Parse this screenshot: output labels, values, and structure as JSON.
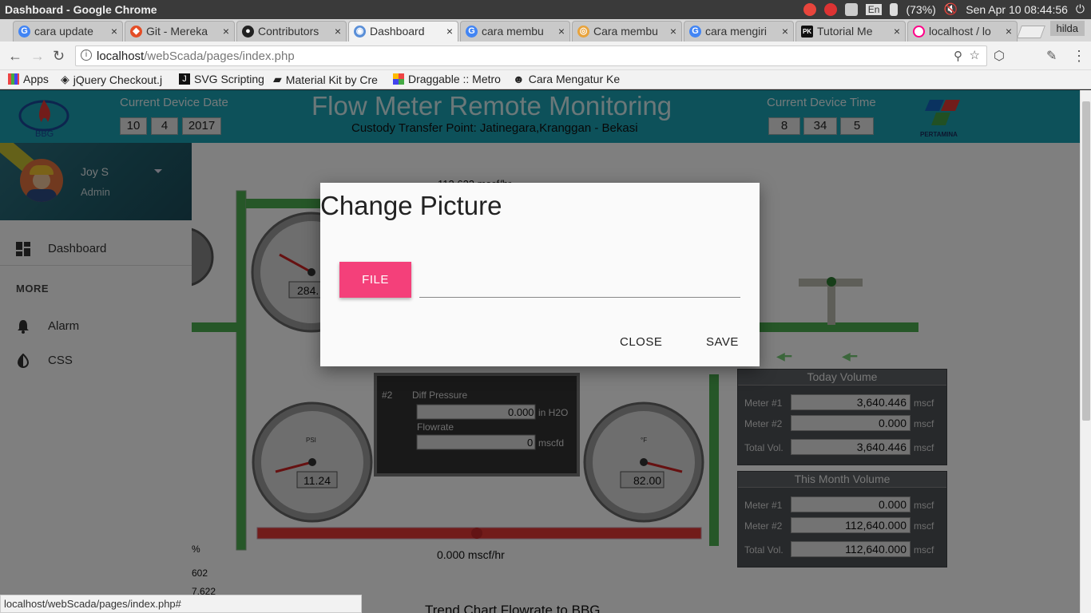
{
  "os": {
    "window_title": "Dashboard - Google Chrome",
    "keyboard": "En",
    "battery": "(73%)",
    "clock": "Sen Apr 10 08:44:56"
  },
  "tabs": [
    {
      "label": "cara update",
      "favicon": "google-icon"
    },
    {
      "label": "Git - Mereka",
      "favicon": "git-icon"
    },
    {
      "label": "Contributors",
      "favicon": "github-icon"
    },
    {
      "label": "Dashboard",
      "favicon": "app-icon"
    },
    {
      "label": "cara membu",
      "favicon": "google-icon"
    },
    {
      "label": "Cara membu",
      "favicon": "site-icon"
    },
    {
      "label": "cara mengiri",
      "favicon": "google-icon"
    },
    {
      "label": "Tutorial Me",
      "favicon": "pk-icon"
    },
    {
      "label": "localhost / lo",
      "favicon": "loading-icon"
    }
  ],
  "profile_chip": "hilda",
  "address": {
    "host": "localhost",
    "path": "/webScada/pages/index.php"
  },
  "bookmarks": [
    {
      "label": "Apps"
    },
    {
      "label": "jQuery Checkout.j"
    },
    {
      "label": "SVG Scripting"
    },
    {
      "label": "Material Kit by Cre"
    },
    {
      "label": "Draggable :: Metro"
    },
    {
      "label": "Cara Mengatur Ke"
    }
  ],
  "header": {
    "title": "Flow Meter Remote Monitoring",
    "subtitle": "Custody Transfer Point: Jatinegara,Kranggan - Bekasi",
    "date_label": "Current Device Date",
    "date": [
      "10",
      "4",
      "2017"
    ],
    "time_label": "Current Device Time",
    "time": [
      "8",
      "34",
      "5"
    ],
    "logo_left": "BBG",
    "logo_right": "PERTAMINA"
  },
  "sidebar": {
    "user_name": "Joy S",
    "user_role": "Admin",
    "items": [
      {
        "label": "Dashboard",
        "icon": "dashboard-icon"
      }
    ],
    "more_header": "MORE",
    "more_items": [
      {
        "label": "Alarm",
        "icon": "bell-icon"
      },
      {
        "label": "CSS",
        "icon": "contrast-icon"
      }
    ]
  },
  "scada": {
    "top_flow_partial": "112.622 mscf/hr",
    "gauge_psi_top_partial": "284.",
    "gauge_psi_bottom": "11.24",
    "gauge_temp": "82.00",
    "gauge_psi_label": "PSI",
    "gauge_temp_label": "°F",
    "bottom_flow": "0.000 mscf/hr",
    "meter2": {
      "id": "#2",
      "diff_label": "Diff Pressure",
      "diff_value": "0.000",
      "diff_unit": "in H2O",
      "flow_label": "Flowrate",
      "flow_value": "0",
      "flow_unit": "mscfd"
    },
    "left_partial_1": "%",
    "left_partial_2": "602",
    "left_partial_3": "7.622",
    "trend_title": "Trend Chart Flowrate to BBG"
  },
  "today_volume": {
    "title": "Today Volume",
    "rows": [
      {
        "label": "Meter #1",
        "value": "3,640.446",
        "unit": "mscf"
      },
      {
        "label": "Meter #2",
        "value": "0.000",
        "unit": "mscf"
      },
      {
        "label": "Total Vol.",
        "value": "3,640.446",
        "unit": "mscf"
      }
    ]
  },
  "month_volume": {
    "title": "This Month Volume",
    "rows": [
      {
        "label": "Meter #1",
        "value": "0.000",
        "unit": "mscf"
      },
      {
        "label": "Meter #2",
        "value": "112,640.000",
        "unit": "mscf"
      },
      {
        "label": "Total Vol.",
        "value": "112,640.000",
        "unit": "mscf"
      }
    ]
  },
  "modal": {
    "title": "Change Picture",
    "file_button": "FILE",
    "file_path_value": "",
    "close": "CLOSE",
    "save": "SAVE"
  },
  "status_url": "localhost/webScada/pages/index.php#",
  "colors": {
    "header": "#1ba2b5",
    "file_button": "#f4407a",
    "pipe_green": "#4caf50",
    "pipe_red": "#e53935"
  }
}
